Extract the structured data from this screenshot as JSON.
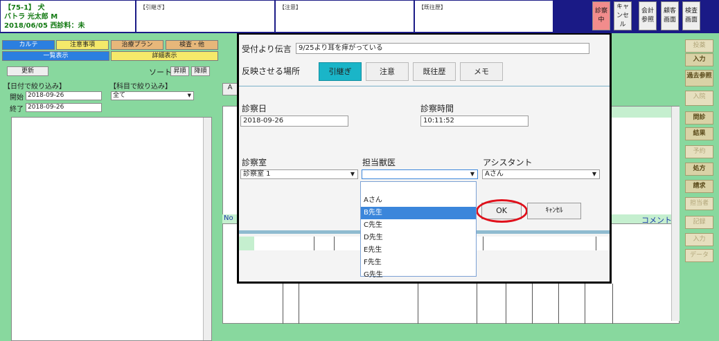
{
  "header": {
    "pet_line1": "【75-1】 犬",
    "pet_line2": "バトラ 光太郎 M",
    "pet_line3": "2018/06/05 西診料：未",
    "box_hikitsugi": "【引継ぎ】",
    "box_chuui": "【注意】",
    "box_kiouureki": "【既往歴】",
    "buttons": [
      "診察中",
      "キャンセル",
      "会計参照",
      "顧客画面",
      "検査画面"
    ]
  },
  "left": {
    "tabs": [
      "カルテ",
      "注意事項",
      "治療プラン",
      "検査・他"
    ],
    "tab_list": "一覧表示",
    "tab_detail": "詳細表示",
    "refresh": "更新",
    "sort_label": "ソート",
    "sort_asc": "昇順",
    "sort_desc": "降順",
    "date_filter": "【日付で絞り込み】",
    "subject_filter": "【科目で絞り込み】",
    "start_label": "開始",
    "end_label": "終了",
    "start_date": "2018-09-26",
    "end_date": "2018-09-26",
    "subject_value": "全て"
  },
  "bg": {
    "no": "No",
    "comment": "コメント",
    "a": "A"
  },
  "right_bar": [
    {
      "label": "投薬",
      "dim": true
    },
    {
      "label": "入力",
      "dim": false
    },
    {
      "label": "過去参照",
      "dim": false
    },
    {
      "label": "入院",
      "dim": true
    },
    {
      "label": "問診",
      "dim": false
    },
    {
      "label": "結果",
      "dim": false
    },
    {
      "label": "予約",
      "dim": true
    },
    {
      "label": "処方",
      "dim": false
    },
    {
      "label": "請求",
      "dim": false
    },
    {
      "label": "担当者",
      "dim": true
    },
    {
      "label": "記録",
      "dim": true
    },
    {
      "label": "入力",
      "dim": true
    },
    {
      "label": "データ",
      "dim": true
    }
  ],
  "modal": {
    "msg_label": "受付より伝言",
    "msg_value": "9/25より耳を痒がっている",
    "place_label": "反映させる場所",
    "place_buttons": [
      "引継ぎ",
      "注意",
      "既往歴",
      "メモ"
    ],
    "date_label": "診察日",
    "date_value": "2018-09-26",
    "time_label": "診察時間",
    "time_value": "10:11:52",
    "room_label": "診察室",
    "room_value": "診察室 1",
    "vet_label": "担当獣医",
    "vet_value": "",
    "assistant_label": "アシスタント",
    "assistant_value": "Aさん",
    "ok": "OK",
    "cancel": "ｷｬﾝｾﾙ"
  },
  "vet_options": [
    "",
    "Aさん",
    "B先生",
    "C先生",
    "D先生",
    "E先生",
    "F先生",
    "G先生"
  ],
  "colors": {
    "accent": "#1ab5c8",
    "selected": "#3b86db",
    "header": "#1a1a86"
  }
}
